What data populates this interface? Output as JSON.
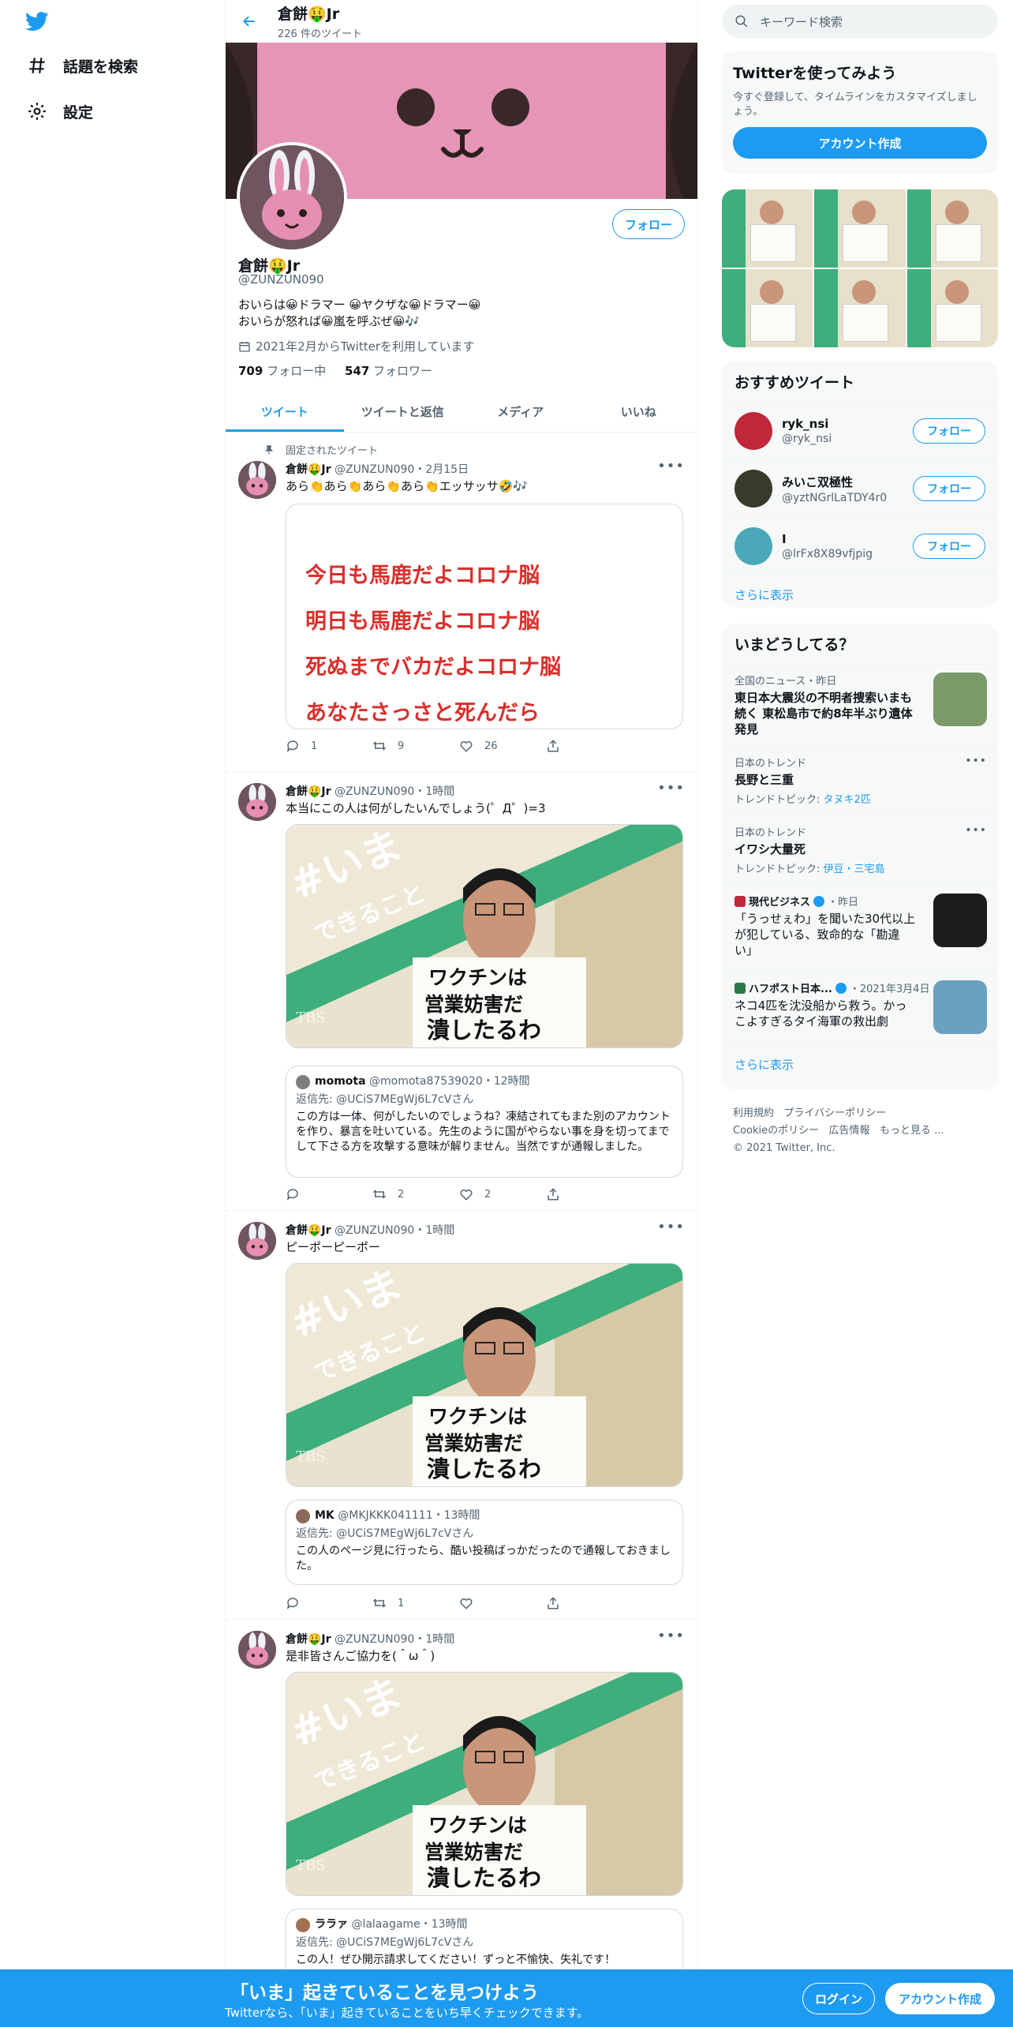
{
  "nav": {
    "explore_label": "話題を検索",
    "settings_label": "設定"
  },
  "header": {
    "name": "倉餅🤑Jr",
    "tweet_count": "226 件のツイート"
  },
  "profile": {
    "name": "倉餅🤑Jr",
    "handle": "@ZUNZUN090",
    "bio_line1": "おいらは😀ドラマー 😀ヤクザな😀ドラマー😀",
    "bio_line2": "おいらが怒れば😀嵐を呼ぶぜ😀🎶",
    "joined": "2021年2月からTwitterを利用しています",
    "following_count": "709",
    "following_label": "フォロー中",
    "followers_count": "547",
    "followers_label": "フォロワー",
    "follow_label": "フォロー"
  },
  "tabs": [
    "ツイート",
    "ツイートと返信",
    "メディア",
    "いいね"
  ],
  "tweets": [
    {
      "pinned_label": "固定されたツイート",
      "name": "倉餅🤑Jr",
      "meta": "@ZUNZUN090・2月15日",
      "text": "あら👏あら👏あら👏あら👏エッサッサ🤣🎶",
      "image_lines": [
        "今日も馬鹿だよコロナ脳",
        "明日も馬鹿だよコロナ脳",
        "死ぬまでバカだよコロナ脳",
        "あなたさっさと死んだら"
      ],
      "reply": "1",
      "retweet": "9",
      "like": "26"
    },
    {
      "name": "倉餅🤑Jr",
      "meta": "@ZUNZUN090・1時間",
      "text": "本当にこの人は何がしたいんでしょう(゜Д゜)=3",
      "quote_name": "momota",
      "quote_meta": "@momota87539020・12時間",
      "quote_reply_to": "返信先: @UCiS7MEgWj6L7cVさん",
      "quote_text": "この方は一体、何がしたいのでしょうね？凍結されてもまた別のアカウントを作り、暴言を吐いている。先生のように国がやらない事を身を切ってまでして下さる方を攻撃する意味が解りません。当然ですが通報しました。",
      "reply": "",
      "retweet": "2",
      "like": "2"
    },
    {
      "name": "倉餅🤑Jr",
      "meta": "@ZUNZUN090・1時間",
      "text": "ピーポーピーポー",
      "quote_name": "MK",
      "quote_meta": "@MKJKKK041111・13時間",
      "quote_reply_to": "返信先: @UCiS7MEgWj6L7cVさん",
      "quote_text": "この人のページ見に行ったら、酷い投稿ばっかだったので通報しておきました。",
      "reply": "",
      "retweet": "1",
      "like": ""
    },
    {
      "name": "倉餅🤑Jr",
      "meta": "@ZUNZUN090・1時間",
      "text": "是非皆さんご協力を(＾ω＾)",
      "quote_name": "ララァ",
      "quote_meta": "@lalaagame・13時間",
      "quote_reply_to": "返信先: @UCiS7MEgWj6L7cVさん",
      "quote_text": "この人！ぜひ開示請求してください！ずっと不愉快、失礼です！"
    }
  ],
  "image_text": {
    "hashtag": "#いま",
    "sub": "できること",
    "sign1": "ワクチンは",
    "sign2": "営業妨害だ",
    "sign3": "潰したるわ",
    "tbs": "TBS"
  },
  "right": {
    "search_placeholder": "キーワード検索",
    "signup_card": {
      "title": "Twitterを使ってみよう",
      "desc": "今すぐ登録して、タイムラインをカスタマイズしましょう。",
      "button": "アカウント作成"
    },
    "recommend_title": "おすすめツイート",
    "recommend": [
      {
        "name": "ryk_nsi",
        "handle": "@ryk_nsi",
        "button": "フォロー"
      },
      {
        "name": "みいこ双極性",
        "handle": "@yztNGrlLaTDY4r0",
        "button": "フォロー"
      },
      {
        "name": "I",
        "handle": "@lrFx8X89vfjpig",
        "button": "フォロー"
      }
    ],
    "show_more": "さらに表示",
    "trends_title": "いまどうしてる？",
    "trends": [
      {
        "meta": "全国のニュース・昨日",
        "title": "東日本大震災の不明者捜索いまも続く 東松島市で約8年半ぶり遺体発見"
      },
      {
        "meta": "日本のトレンド",
        "title": "長野と三重",
        "sub_prefix": "トレンドトピック: ",
        "sub_topic": "タヌキ2匹"
      },
      {
        "meta": "日本のトレンド",
        "title": "イワシ大量死",
        "sub_prefix": "トレンドトピック: ",
        "sub_topic": "伊豆・三宅島"
      },
      {
        "source": "現代ビジネス",
        "meta": "・昨日",
        "title": "「うっせぇわ」を聞いた30代以上が犯している、致命的な「勘違い」"
      },
      {
        "source": "ハフポスト日本...",
        "meta": "・2021年3月4日",
        "title": "ネコ4匹を沈没船から救う。かっこよすぎるタイ海軍の救出劇"
      }
    ],
    "trends_more": "さらに表示",
    "footer": {
      "terms": "利用規約",
      "privacy": "プライバシーポリシー",
      "cookie": "Cookieのポリシー",
      "ads": "広告情報",
      "more": "もっと見る ...",
      "copyright": "© 2021 Twitter, Inc."
    }
  },
  "bottom": {
    "title": "「いま」起きていることを見つけよう",
    "subtitle": "Twitterなら、「いま」起きていることをいち早くチェックできます。",
    "login": "ログイン",
    "signup": "アカウント作成"
  },
  "colors": {
    "accent": "#1d9bf0",
    "banner": "#e595b5",
    "green": "#3dae7c",
    "red_text": "#d9302c"
  }
}
